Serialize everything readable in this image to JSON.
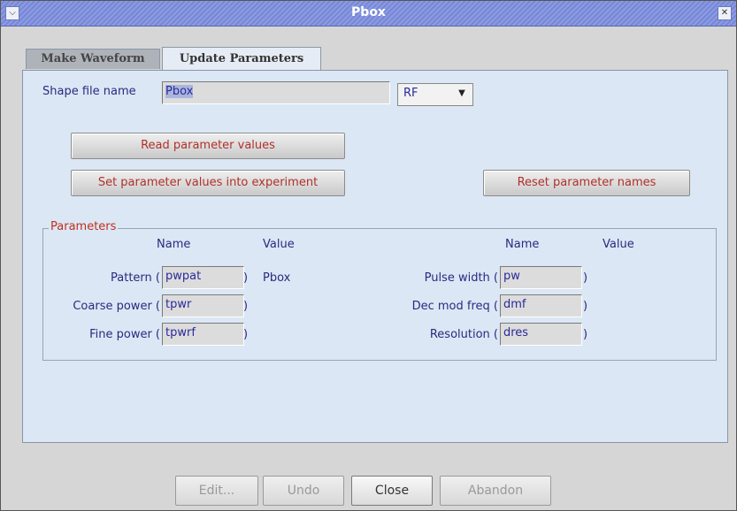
{
  "window": {
    "title": "Pbox"
  },
  "tabs": [
    {
      "label": "Make Waveform",
      "active": false
    },
    {
      "label": "Update Parameters",
      "active": true
    }
  ],
  "shape": {
    "label": "Shape file name",
    "value": "Pbox",
    "channel": "RF"
  },
  "buttons": {
    "read": "Read parameter values",
    "set": "Set parameter values into experiment",
    "reset": "Reset parameter names"
  },
  "parameters": {
    "legend": "Parameters",
    "left": {
      "name_header": "Name",
      "value_header": "Value",
      "rows": [
        {
          "label": "Pattern (",
          "name": "pwpat",
          "value": "Pbox"
        },
        {
          "label": "Coarse power (",
          "name": "tpwr",
          "value": ""
        },
        {
          "label": "Fine power (",
          "name": "tpwrf",
          "value": ""
        }
      ]
    },
    "right": {
      "name_header": "Name",
      "value_header": "Value",
      "rows": [
        {
          "label": "Pulse width (",
          "name": "pw",
          "value": ""
        },
        {
          "label": "Dec mod freq (",
          "name": "dmf",
          "value": ""
        },
        {
          "label": "Resolution (",
          "name": "dres",
          "value": ""
        }
      ]
    }
  },
  "footer": {
    "edit": "Edit...",
    "undo": "Undo",
    "close": "Close",
    "abandon": "Abandon"
  },
  "colors": {
    "panel": "#dbe7f4",
    "titlebar": "#7f8fda",
    "button_text": "#b0302a",
    "label_text": "#2a2a80"
  }
}
